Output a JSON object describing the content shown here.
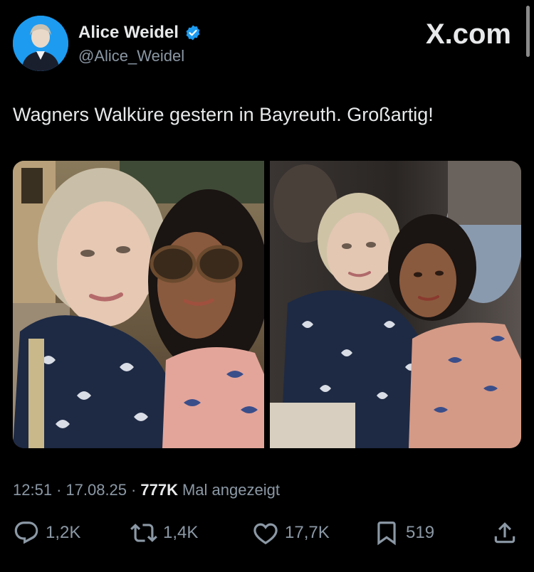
{
  "author": {
    "display_name": "Alice Weidel",
    "handle": "@Alice_Weidel",
    "verified_icon": "verified-badge-icon",
    "avatar_icon": "avatar-photo"
  },
  "brand": "X.com",
  "tweet": {
    "text": "Wagners Walküre gestern in Bayreuth. Großartig!"
  },
  "media": [
    {
      "kind": "photo",
      "name": "selfie-photo-outdoor"
    },
    {
      "kind": "photo",
      "name": "photo-indoor-event"
    }
  ],
  "meta": {
    "time": "12:51",
    "separator": "·",
    "date": "17.08.25",
    "views_count": "777K",
    "views_label": "Mal angezeigt"
  },
  "actions": {
    "reply_count": "1,2K",
    "repost_count": "1,4K",
    "like_count": "17,7K",
    "bookmark_count": "519"
  },
  "colors": {
    "background": "#000000",
    "text_primary": "#e7e9ea",
    "text_secondary": "#8b98a5",
    "verified": "#1d9bf0"
  }
}
